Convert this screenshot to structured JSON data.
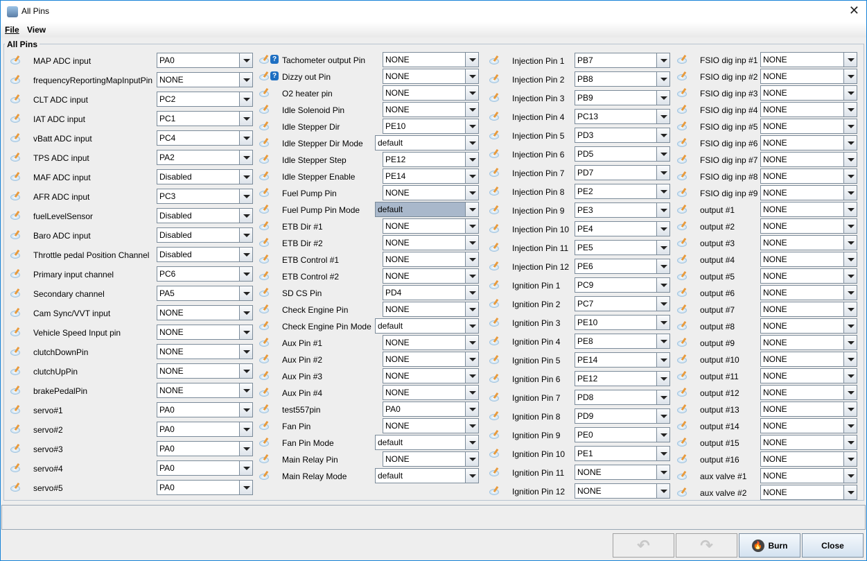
{
  "window": {
    "title": "All Pins",
    "close": "✕"
  },
  "menu": [
    "File",
    "View"
  ],
  "group_title": "All Pins",
  "columns": [
    {
      "rows": [
        {
          "label": "MAP ADC input",
          "value": "PA0"
        },
        {
          "label": "frequencyReportingMapInputPin",
          "value": "NONE"
        },
        {
          "label": "CLT ADC input",
          "value": "PC2"
        },
        {
          "label": "IAT ADC input",
          "value": "PC1"
        },
        {
          "label": "vBatt ADC input",
          "value": "PC4"
        },
        {
          "label": "TPS ADC input",
          "value": "PA2"
        },
        {
          "label": "MAF ADC input",
          "value": "Disabled"
        },
        {
          "label": "AFR ADC input",
          "value": "PC3"
        },
        {
          "label": "fuelLevelSensor",
          "value": "Disabled"
        },
        {
          "label": "Baro ADC input",
          "value": "Disabled"
        },
        {
          "label": "Throttle pedal Position Channel",
          "value": "Disabled"
        },
        {
          "label": "Primary input channel",
          "value": "PC6"
        },
        {
          "label": "Secondary channel",
          "value": "PA5"
        },
        {
          "label": "Cam Sync/VVT input",
          "value": "NONE"
        },
        {
          "label": "Vehicle Speed Input pin",
          "value": "NONE"
        },
        {
          "label": "clutchDownPin",
          "value": "NONE"
        },
        {
          "label": "clutchUpPin",
          "value": "NONE"
        },
        {
          "label": "brakePedalPin",
          "value": "NONE"
        },
        {
          "label": "servo#1",
          "value": "PA0"
        },
        {
          "label": "servo#2",
          "value": "PA0"
        },
        {
          "label": "servo#3",
          "value": "PA0"
        },
        {
          "label": "servo#4",
          "value": "PA0"
        },
        {
          "label": "servo#5",
          "value": "PA0"
        }
      ]
    },
    {
      "rows": [
        {
          "label": "Tachometer output Pin",
          "value": "NONE",
          "help": "?"
        },
        {
          "label": "Dizzy out Pin",
          "value": "NONE",
          "help": "?"
        },
        {
          "label": "O2 heater pin",
          "value": "NONE"
        },
        {
          "label": "Idle Solenoid Pin",
          "value": "NONE"
        },
        {
          "label": "Idle Stepper Dir",
          "value": "PE10"
        },
        {
          "label": "Idle Stepper Dir Mode",
          "value": "default",
          "wide": true
        },
        {
          "label": "Idle Stepper Step",
          "value": "PE12"
        },
        {
          "label": "Idle Stepper Enable",
          "value": "PE14"
        },
        {
          "label": "Fuel Pump Pin",
          "value": "NONE"
        },
        {
          "label": "Fuel Pump Pin Mode",
          "value": "default",
          "wide": true,
          "selected": true
        },
        {
          "label": "ETB Dir #1",
          "value": "NONE"
        },
        {
          "label": "ETB Dir #2",
          "value": "NONE"
        },
        {
          "label": "ETB Control #1",
          "value": "NONE"
        },
        {
          "label": "ETB Control #2",
          "value": "NONE"
        },
        {
          "label": "SD CS Pin",
          "value": "PD4"
        },
        {
          "label": "Check Engine Pin",
          "value": "NONE"
        },
        {
          "label": "Check Engine Pin Mode",
          "value": "default",
          "wide": true
        },
        {
          "label": "Aux Pin #1",
          "value": "NONE"
        },
        {
          "label": "Aux Pin #2",
          "value": "NONE"
        },
        {
          "label": "Aux Pin #3",
          "value": "NONE"
        },
        {
          "label": "Aux Pin #4",
          "value": "NONE"
        },
        {
          "label": "test557pin",
          "value": "PA0"
        },
        {
          "label": "Fan Pin",
          "value": "NONE"
        },
        {
          "label": "Fan Pin Mode",
          "value": "default",
          "wide": true
        },
        {
          "label": "Main Relay Pin",
          "value": "NONE"
        },
        {
          "label": "Main Relay Mode",
          "value": "default",
          "wide": true
        }
      ]
    },
    {
      "rows": [
        {
          "label": "Injection Pin 1",
          "value": "PB7"
        },
        {
          "label": "Injection Pin 2",
          "value": "PB8"
        },
        {
          "label": "Injection Pin 3",
          "value": "PB9"
        },
        {
          "label": "Injection Pin 4",
          "value": "PC13"
        },
        {
          "label": "Injection Pin 5",
          "value": "PD3"
        },
        {
          "label": "Injection Pin 6",
          "value": "PD5"
        },
        {
          "label": "Injection Pin 7",
          "value": "PD7"
        },
        {
          "label": "Injection Pin 8",
          "value": "PE2"
        },
        {
          "label": "Injection Pin 9",
          "value": "PE3"
        },
        {
          "label": "Injection Pin 10",
          "value": "PE4"
        },
        {
          "label": "Injection Pin 11",
          "value": "PE5"
        },
        {
          "label": "Injection Pin 12",
          "value": "PE6"
        },
        {
          "label": "Ignition Pin 1",
          "value": "PC9"
        },
        {
          "label": "Ignition Pin 2",
          "value": "PC7"
        },
        {
          "label": "Ignition Pin 3",
          "value": "PE10"
        },
        {
          "label": "Ignition Pin 4",
          "value": "PE8"
        },
        {
          "label": "Ignition Pin 5",
          "value": "PE14"
        },
        {
          "label": "Ignition Pin 6",
          "value": "PE12"
        },
        {
          "label": "Ignition Pin 7",
          "value": "PD8"
        },
        {
          "label": "Ignition Pin 8",
          "value": "PD9"
        },
        {
          "label": "Ignition Pin 9",
          "value": "PE0"
        },
        {
          "label": "Ignition Pin 10",
          "value": "PE1"
        },
        {
          "label": "Ignition Pin 11",
          "value": "NONE"
        },
        {
          "label": "Ignition Pin 12",
          "value": "NONE"
        }
      ]
    },
    {
      "rows": [
        {
          "label": "FSIO dig inp #1",
          "value": "NONE"
        },
        {
          "label": "FSIO dig inp #2",
          "value": "NONE"
        },
        {
          "label": "FSIO dig inp #3",
          "value": "NONE"
        },
        {
          "label": "FSIO dig inp #4",
          "value": "NONE"
        },
        {
          "label": "FSIO dig inp #5",
          "value": "NONE"
        },
        {
          "label": "FSIO dig inp #6",
          "value": "NONE"
        },
        {
          "label": "FSIO dig inp #7",
          "value": "NONE"
        },
        {
          "label": "FSIO dig inp #8",
          "value": "NONE"
        },
        {
          "label": "FSIO dig inp #9",
          "value": "NONE"
        },
        {
          "label": "output #1",
          "value": "NONE"
        },
        {
          "label": "output #2",
          "value": "NONE"
        },
        {
          "label": "output #3",
          "value": "NONE"
        },
        {
          "label": "output #4",
          "value": "NONE"
        },
        {
          "label": "output #5",
          "value": "NONE"
        },
        {
          "label": "output #6",
          "value": "NONE"
        },
        {
          "label": "output #7",
          "value": "NONE"
        },
        {
          "label": "output #8",
          "value": "NONE"
        },
        {
          "label": "output #9",
          "value": "NONE"
        },
        {
          "label": "output #10",
          "value": "NONE"
        },
        {
          "label": "output #11",
          "value": "NONE"
        },
        {
          "label": "output #12",
          "value": "NONE"
        },
        {
          "label": "output #13",
          "value": "NONE"
        },
        {
          "label": "output #14",
          "value": "NONE"
        },
        {
          "label": "output #15",
          "value": "NONE"
        },
        {
          "label": "output #16",
          "value": "NONE"
        },
        {
          "label": "aux valve #1",
          "value": "NONE"
        },
        {
          "label": "aux valve #2",
          "value": "NONE"
        }
      ]
    }
  ],
  "buttons": {
    "undo": "undo-icon",
    "redo": "redo-icon",
    "burn": "Burn",
    "close": "Close"
  }
}
